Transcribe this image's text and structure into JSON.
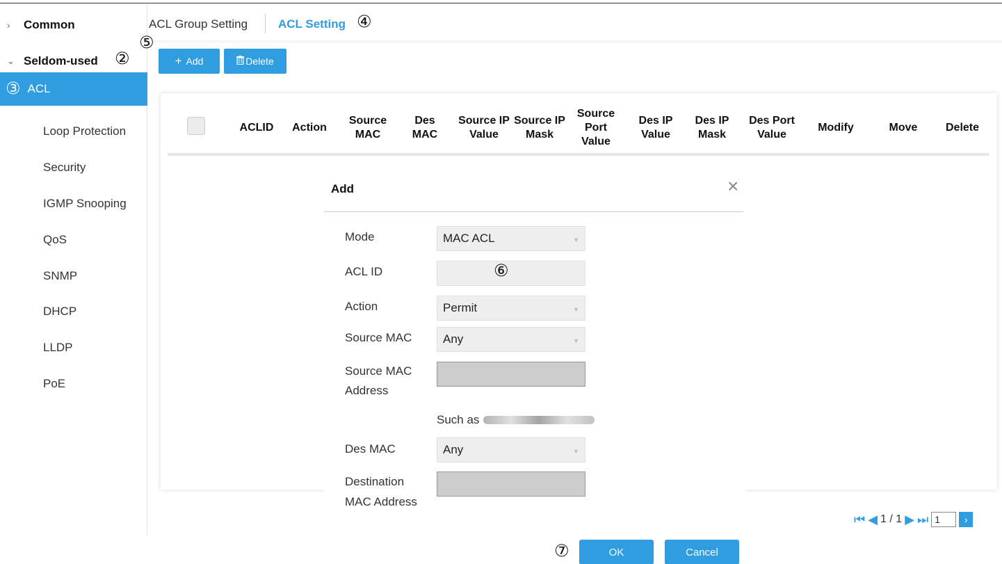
{
  "sidebar": {
    "common_label": "Common",
    "seldom_label": "Seldom-used",
    "seldom_marker": "②",
    "active": {
      "marker": "③",
      "label": "ACL"
    },
    "items": [
      "Loop Protection",
      "Security",
      "IGMP Snooping",
      "QoS",
      "SNMP",
      "DHCP",
      "LLDP",
      "PoE"
    ]
  },
  "tabs": {
    "group": "ACL Group Setting",
    "acl": "ACL Setting",
    "acl_marker": "④"
  },
  "toolbar": {
    "marker": "⑤",
    "add_label": "Add",
    "delete_label": "Delete"
  },
  "table": {
    "headers": [
      "ACLID",
      "Action",
      "Source MAC",
      "Des MAC",
      "Source IP Value",
      "Source IP Mask",
      "Source Port Value",
      "Des IP Value",
      "Des IP Mask",
      "Des Port Value",
      "Modify",
      "Move",
      "Delete"
    ]
  },
  "modal": {
    "title": "Add",
    "close_icon": "×",
    "marker": "⑥",
    "fields": {
      "mode_label": "Mode",
      "mode_value": "MAC ACL",
      "aclid_label": "ACL ID",
      "action_label": "Action",
      "action_value": "Permit",
      "srcmac_label": "Source MAC",
      "srcmac_value": "Any",
      "srcmacaddr_label_1": "Source MAC",
      "srcmacaddr_label_2": "Address",
      "hint": "Such as",
      "desmac_label": "Des MAC",
      "desmac_value": "Any",
      "dstmacaddr_label_1": "Destination",
      "dstmacaddr_label_2": "MAC Address"
    }
  },
  "pager": {
    "text": "1 / 1",
    "page_input": "1"
  },
  "footer": {
    "marker": "⑦",
    "ok_label": "OK",
    "cancel_label": "Cancel"
  },
  "colors": {
    "accent": "#2f9de0"
  }
}
